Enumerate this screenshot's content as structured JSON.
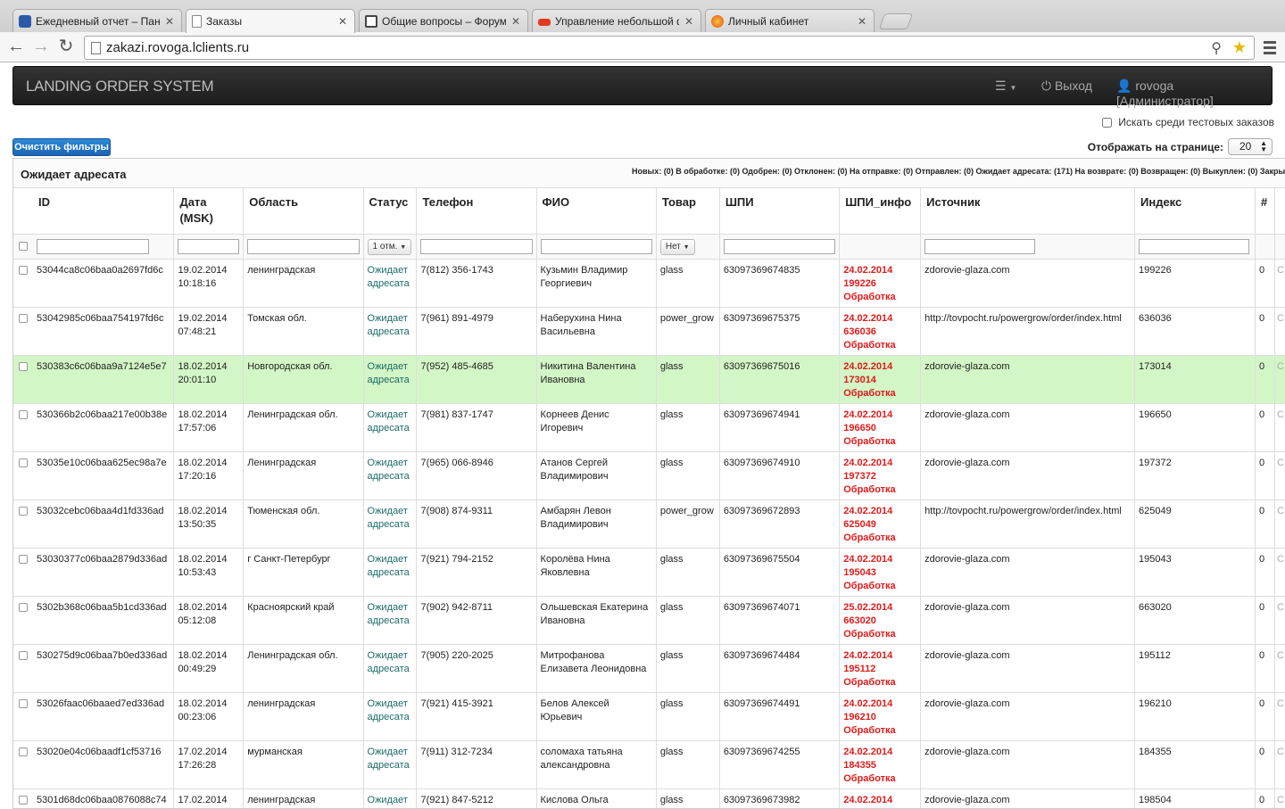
{
  "browser": {
    "tabs": [
      {
        "title": "Ежедневный отчет – Пане",
        "color": "#2d5aa8"
      },
      {
        "title": "Заказы",
        "color": "#ffffff"
      },
      {
        "title": "Общие вопросы – Форум",
        "color": "#444444"
      },
      {
        "title": "Управление небольшой ф",
        "color": "#e33a1f"
      },
      {
        "title": "Личный кабинет",
        "color": "#f1a21a"
      }
    ],
    "url": "zakazi.rovoga.lclients.ru"
  },
  "app": {
    "brand": "LANDING ORDER SYSTEM",
    "logout": "Выход",
    "user": "rovoga [Администратор]",
    "test_orders_label": "Искать среди тестовых заказов",
    "clear_filters": "Очистить фильтры",
    "per_page_label": "Отображать на странице:",
    "per_page_value": "20",
    "panel_title": "Ожидает адресата",
    "counts": "Новых: (0) В обработке: (0) Одобрен: (0) Отклонен: (0) На отправке: (0) Отправлен: (0) Ожидает адресата: (171) На возврате: (0) Возвращен: (0) Выкуплен: (0) Закры"
  },
  "table": {
    "headers": {
      "id": "ID",
      "date": "Дата (MSK)",
      "region": "Область",
      "status": "Статус",
      "phone": "Телефон",
      "name": "ФИО",
      "product": "Товар",
      "spi": "ШПИ",
      "spi_info": "ШПИ_инфо",
      "source": "Источник",
      "index": "Индекс",
      "num": "#"
    },
    "filters": {
      "status": "1 отм.",
      "product": "Нет"
    },
    "rows": [
      {
        "id": "53044ca8c06baa0a2697fd6c",
        "date": "19.02.2014",
        "time": "10:18:16",
        "region": "ленинградская",
        "status1": "Ожидает",
        "status2": "адресата",
        "phone": "7(812) 356-1743",
        "name1": "Кузьмин Владимир",
        "name2": "Георгиевич",
        "product": "glass",
        "spi": "63097369674835",
        "info_date": "24.02.2014",
        "info_index": "199226",
        "info_state": "Обработка",
        "source": "zdorovie-glaza.com",
        "index": "199226",
        "num": "0"
      },
      {
        "id": "53042985c06baa754197fd6c",
        "date": "19.02.2014",
        "time": "07:48:21",
        "region": "Томская обл.",
        "status1": "Ожидает",
        "status2": "адресата",
        "phone": "7(961) 891-4979",
        "name1": "Наберухина Нина",
        "name2": "Васильевна",
        "product": "power_grow",
        "spi": "63097369675375",
        "info_date": "24.02.2014",
        "info_index": "636036",
        "info_state": "Обработка",
        "source": "http://tovpocht.ru/powergrow/order/index.html",
        "index": "636036",
        "num": "0"
      },
      {
        "id": "530383c6c06baa9a7124e5e7",
        "date": "18.02.2014",
        "time": "20:01:10",
        "region": "Новгородская обл.",
        "status1": "Ожидает",
        "status2": "адресата",
        "phone": "7(952) 485-4685",
        "name1": "Никитина Валентина",
        "name2": "Ивановна",
        "product": "glass",
        "spi": "63097369675016",
        "info_date": "24.02.2014",
        "info_index": "173014",
        "info_state": "Обработка",
        "source": "zdorovie-glaza.com",
        "index": "173014",
        "num": "0",
        "highlight": true
      },
      {
        "id": "530366b2c06baa217e00b38e",
        "date": "18.02.2014",
        "time": "17:57:06",
        "region": "Ленинградская обл.",
        "status1": "Ожидает",
        "status2": "адресата",
        "phone": "7(981) 837-1747",
        "name1": "Корнеев Денис",
        "name2": "Игоревич",
        "product": "glass",
        "spi": "63097369674941",
        "info_date": "24.02.2014",
        "info_index": "196650",
        "info_state": "Обработка",
        "source": "zdorovie-glaza.com",
        "index": "196650",
        "num": "0"
      },
      {
        "id": "53035e10c06baa625ec98a7e",
        "date": "18.02.2014",
        "time": "17:20:16",
        "region": "Ленинградская",
        "status1": "Ожидает",
        "status2": "адресата",
        "phone": "7(965) 066-8946",
        "name1": "Атанов Сергей",
        "name2": "Владимирович",
        "product": "glass",
        "spi": "63097369674910",
        "info_date": "24.02.2014",
        "info_index": "197372",
        "info_state": "Обработка",
        "source": "zdorovie-glaza.com",
        "index": "197372",
        "num": "0"
      },
      {
        "id": "53032cebc06baa4d1fd336ad",
        "date": "18.02.2014",
        "time": "13:50:35",
        "region": "Тюменская обл.",
        "status1": "Ожидает",
        "status2": "адресата",
        "phone": "7(908) 874-9311",
        "name1": "Амбарян Левон",
        "name2": "Владимирович",
        "product": "power_grow",
        "spi": "63097369672893",
        "info_date": "24.02.2014",
        "info_index": "625049",
        "info_state": "Обработка",
        "source": "http://tovpocht.ru/powergrow/order/index.html",
        "index": "625049",
        "num": "0"
      },
      {
        "id": "53030377c06baa2879d336ad",
        "date": "18.02.2014",
        "time": "10:53:43",
        "region": "г Санкт-Петербург",
        "status1": "Ожидает",
        "status2": "адресата",
        "phone": "7(921) 794-2152",
        "name1": "Королёва Нина",
        "name2": "Яковлевна",
        "product": "glass",
        "spi": "63097369675504",
        "info_date": "24.02.2014",
        "info_index": "195043",
        "info_state": "Обработка",
        "source": "zdorovie-glaza.com",
        "index": "195043",
        "num": "0"
      },
      {
        "id": "5302b368c06baa5b1cd336ad",
        "date": "18.02.2014",
        "time": "05:12:08",
        "region": "Красноярский край",
        "status1": "Ожидает",
        "status2": "адресата",
        "phone": "7(902) 942-8711",
        "name1": "Ольшевская Екатерина",
        "name2": "Ивановна",
        "product": "glass",
        "spi": "63097369674071",
        "info_date": "25.02.2014",
        "info_index": "663020",
        "info_state": "Обработка",
        "source": "zdorovie-glaza.com",
        "index": "663020",
        "num": "0"
      },
      {
        "id": "530275d9c06baa7b0ed336ad",
        "date": "18.02.2014",
        "time": "00:49:29",
        "region": "Ленинградская обл.",
        "status1": "Ожидает",
        "status2": "адресата",
        "phone": "7(905) 220-2025",
        "name1": "Митрофанова",
        "name2": "Елизавета Леонидовна",
        "product": "glass",
        "spi": "63097369674484",
        "info_date": "24.02.2014",
        "info_index": "195112",
        "info_state": "Обработка",
        "source": "zdorovie-glaza.com",
        "index": "195112",
        "num": "0"
      },
      {
        "id": "53026faac06baaed7ed336ad",
        "date": "18.02.2014",
        "time": "00:23:06",
        "region": "ленинградская",
        "status1": "Ожидает",
        "status2": "адресата",
        "phone": "7(921) 415-3921",
        "name1": "Белов Алексей",
        "name2": "Юрьевич",
        "product": "glass",
        "spi": "63097369674491",
        "info_date": "24.02.2014",
        "info_index": "196210",
        "info_state": "Обработка",
        "source": "zdorovie-glaza.com",
        "index": "196210",
        "num": "0"
      },
      {
        "id": "53020e04c06baadf1cf53716",
        "date": "17.02.2014",
        "time": "17:26:28",
        "region": "мурманская",
        "status1": "Ожидает",
        "status2": "адресата",
        "phone": "7(911) 312-7234",
        "name1": "соломаха татьяна",
        "name2": "александровна",
        "product": "glass",
        "spi": "63097369674255",
        "info_date": "24.02.2014",
        "info_index": "184355",
        "info_state": "Обработка",
        "source": "zdorovie-glaza.com",
        "index": "184355",
        "num": "0"
      },
      {
        "id": "5301d68dc06baa0876088c74",
        "date": "17.02.2014",
        "time": "",
        "region": "ленинградская",
        "status1": "Ожидает",
        "status2": "",
        "phone": "7(921) 847-5212",
        "name1": "Кислова Ольга",
        "name2": "",
        "product": "glass",
        "spi": "63097369673982",
        "info_date": "24.02.2014",
        "info_index": "",
        "info_state": "",
        "source": "zdorovie-glaza.com",
        "index": "198504",
        "num": "0"
      }
    ]
  }
}
